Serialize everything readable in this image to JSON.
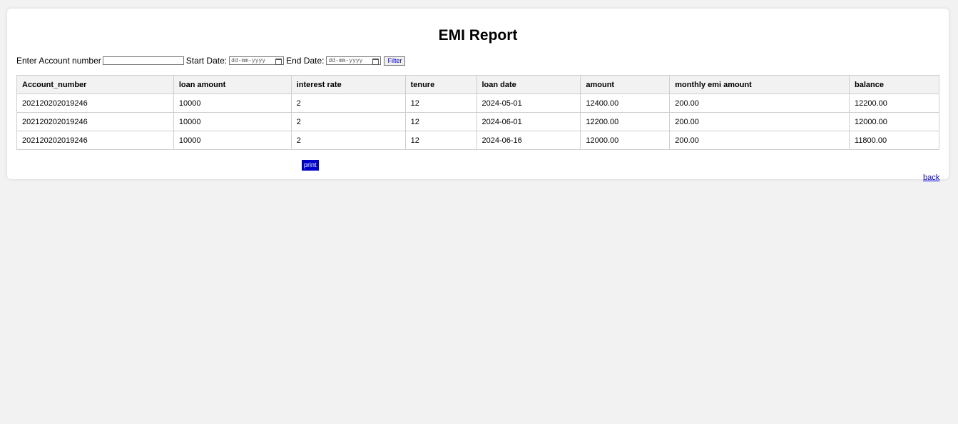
{
  "page": {
    "title": "EMI Report"
  },
  "filter": {
    "account_label": "Enter Account number",
    "account_value": "",
    "start_label": "Start Date:",
    "start_placeholder": "dd-mm-yyyy",
    "end_label": "End Date:",
    "end_placeholder": "dd-mm-yyyy",
    "filter_button": "Filter"
  },
  "table": {
    "headers": [
      "Account_number",
      "loan amount",
      "interest rate",
      "tenure",
      "loan date",
      "amount",
      "monthly emi amount",
      "balance"
    ],
    "rows": [
      [
        "202120202019246",
        "10000",
        "2",
        "12",
        "2024-05-01",
        "12400.00",
        "200.00",
        "12200.00"
      ],
      [
        "202120202019246",
        "10000",
        "2",
        "12",
        "2024-06-01",
        "12200.00",
        "200.00",
        "12000.00"
      ],
      [
        "202120202019246",
        "10000",
        "2",
        "12",
        "2024-06-16",
        "12000.00",
        "200.00",
        "11800.00"
      ]
    ]
  },
  "actions": {
    "print_label": "print",
    "back_label": "back"
  },
  "colors": {
    "background": "#f2f2f2",
    "card": "#ffffff",
    "print_button": "#0000cc",
    "link": "#0000ee"
  }
}
